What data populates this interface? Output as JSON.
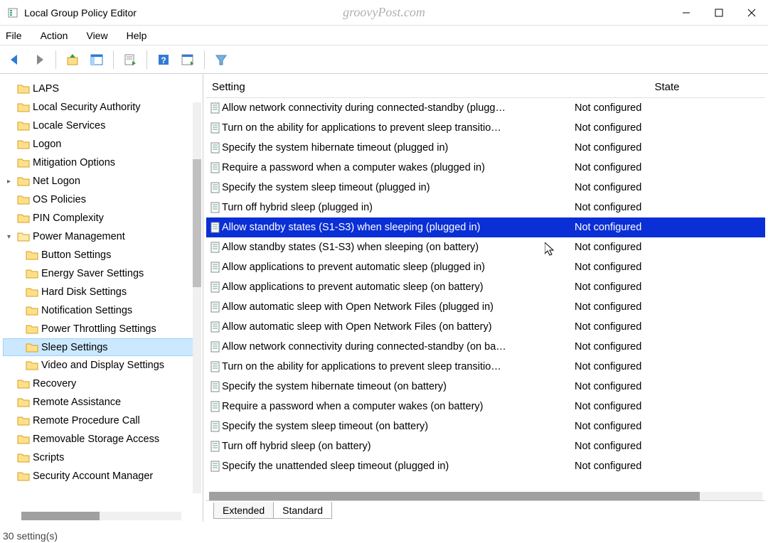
{
  "window": {
    "title": "Local Group Policy Editor",
    "watermark": "groovyPost.com"
  },
  "menubar": [
    "File",
    "Action",
    "View",
    "Help"
  ],
  "tree": [
    {
      "label": "LAPS",
      "level": 1,
      "exp": false
    },
    {
      "label": "Local Security Authority",
      "level": 1,
      "exp": false
    },
    {
      "label": "Locale Services",
      "level": 1,
      "exp": false
    },
    {
      "label": "Logon",
      "level": 1,
      "exp": false
    },
    {
      "label": "Mitigation Options",
      "level": 1,
      "exp": false
    },
    {
      "label": "Net Logon",
      "level": 1,
      "exp": true
    },
    {
      "label": "OS Policies",
      "level": 1,
      "exp": false
    },
    {
      "label": "PIN Complexity",
      "level": 1,
      "exp": false
    },
    {
      "label": "Power Management",
      "level": 1,
      "exp": true,
      "open": true
    },
    {
      "label": "Button Settings",
      "level": 2,
      "exp": false
    },
    {
      "label": "Energy Saver Settings",
      "level": 2,
      "exp": false
    },
    {
      "label": "Hard Disk Settings",
      "level": 2,
      "exp": false
    },
    {
      "label": "Notification Settings",
      "level": 2,
      "exp": false
    },
    {
      "label": "Power Throttling Settings",
      "level": 2,
      "exp": false
    },
    {
      "label": "Sleep Settings",
      "level": 2,
      "exp": false,
      "selected": true
    },
    {
      "label": "Video and Display Settings",
      "level": 2,
      "exp": false
    },
    {
      "label": "Recovery",
      "level": 1,
      "exp": false
    },
    {
      "label": "Remote Assistance",
      "level": 1,
      "exp": false
    },
    {
      "label": "Remote Procedure Call",
      "level": 1,
      "exp": false
    },
    {
      "label": "Removable Storage Access",
      "level": 1,
      "exp": false
    },
    {
      "label": "Scripts",
      "level": 1,
      "exp": false
    },
    {
      "label": "Security Account Manager",
      "level": 1,
      "exp": false
    }
  ],
  "columns": {
    "setting": "Setting",
    "state": "State"
  },
  "settings": [
    {
      "name": "Allow network connectivity during connected-standby (plugg…",
      "state": "Not configured"
    },
    {
      "name": "Turn on the ability for applications to prevent sleep transitio…",
      "state": "Not configured"
    },
    {
      "name": "Specify the system hibernate timeout (plugged in)",
      "state": "Not configured"
    },
    {
      "name": "Require a password when a computer wakes (plugged in)",
      "state": "Not configured"
    },
    {
      "name": "Specify the system sleep timeout (plugged in)",
      "state": "Not configured"
    },
    {
      "name": "Turn off hybrid sleep (plugged in)",
      "state": "Not configured"
    },
    {
      "name": "Allow standby states (S1-S3) when sleeping (plugged in)",
      "state": "Not configured",
      "selected": true
    },
    {
      "name": "Allow standby states (S1-S3) when sleeping (on battery)",
      "state": "Not configured"
    },
    {
      "name": "Allow applications to prevent automatic sleep (plugged in)",
      "state": "Not configured"
    },
    {
      "name": "Allow applications to prevent automatic sleep (on battery)",
      "state": "Not configured"
    },
    {
      "name": "Allow automatic sleep with Open Network Files (plugged in)",
      "state": "Not configured"
    },
    {
      "name": "Allow automatic sleep with Open Network Files (on battery)",
      "state": "Not configured"
    },
    {
      "name": "Allow network connectivity during connected-standby (on ba…",
      "state": "Not configured"
    },
    {
      "name": "Turn on the ability for applications to prevent sleep transitio…",
      "state": "Not configured"
    },
    {
      "name": "Specify the system hibernate timeout (on battery)",
      "state": "Not configured"
    },
    {
      "name": "Require a password when a computer wakes (on battery)",
      "state": "Not configured"
    },
    {
      "name": "Specify the system sleep timeout (on battery)",
      "state": "Not configured"
    },
    {
      "name": "Turn off hybrid sleep (on battery)",
      "state": "Not configured"
    },
    {
      "name": "Specify the unattended sleep timeout (plugged in)",
      "state": "Not configured"
    }
  ],
  "tabs": {
    "extended": "Extended",
    "standard": "Standard"
  },
  "status": "30 setting(s)"
}
